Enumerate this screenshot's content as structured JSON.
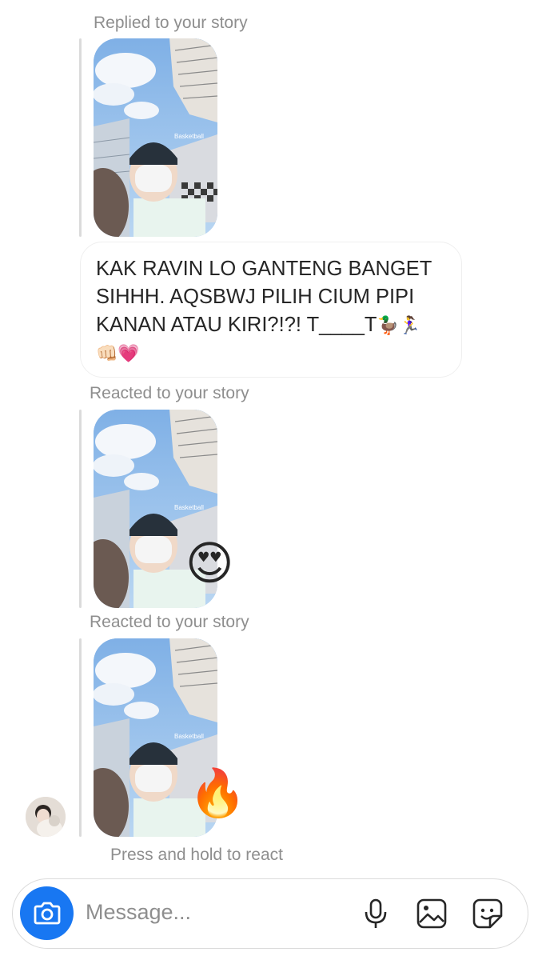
{
  "thread": {
    "replied_label": "Replied to your story",
    "message_line1": "KAK RAVIN LO GANTENG BANGET",
    "message_line2": "SIHHH. AQSBWJ PILIH CIUM PIPI",
    "message_line3": "KANAN ATAU KIRI?!?! T____T",
    "message_emoji_a": "🦆🏃‍♀️",
    "message_emoji_b": "👊🏻💗",
    "reacted_label_1": "Reacted to your story",
    "reaction_1": "😍",
    "reacted_label_2": "Reacted to your story",
    "reaction_2": "🔥",
    "story_caption": "Basketball",
    "hint": "Press and hold to react"
  },
  "composer": {
    "placeholder": "Message...",
    "accent": "#1877f2",
    "icons": [
      "camera-icon",
      "microphone-icon",
      "gallery-icon",
      "sticker-icon"
    ]
  },
  "colors": {
    "meta_text": "#8e8e8e",
    "bubble_border": "#efefef",
    "rail": "#dbdbdb"
  }
}
